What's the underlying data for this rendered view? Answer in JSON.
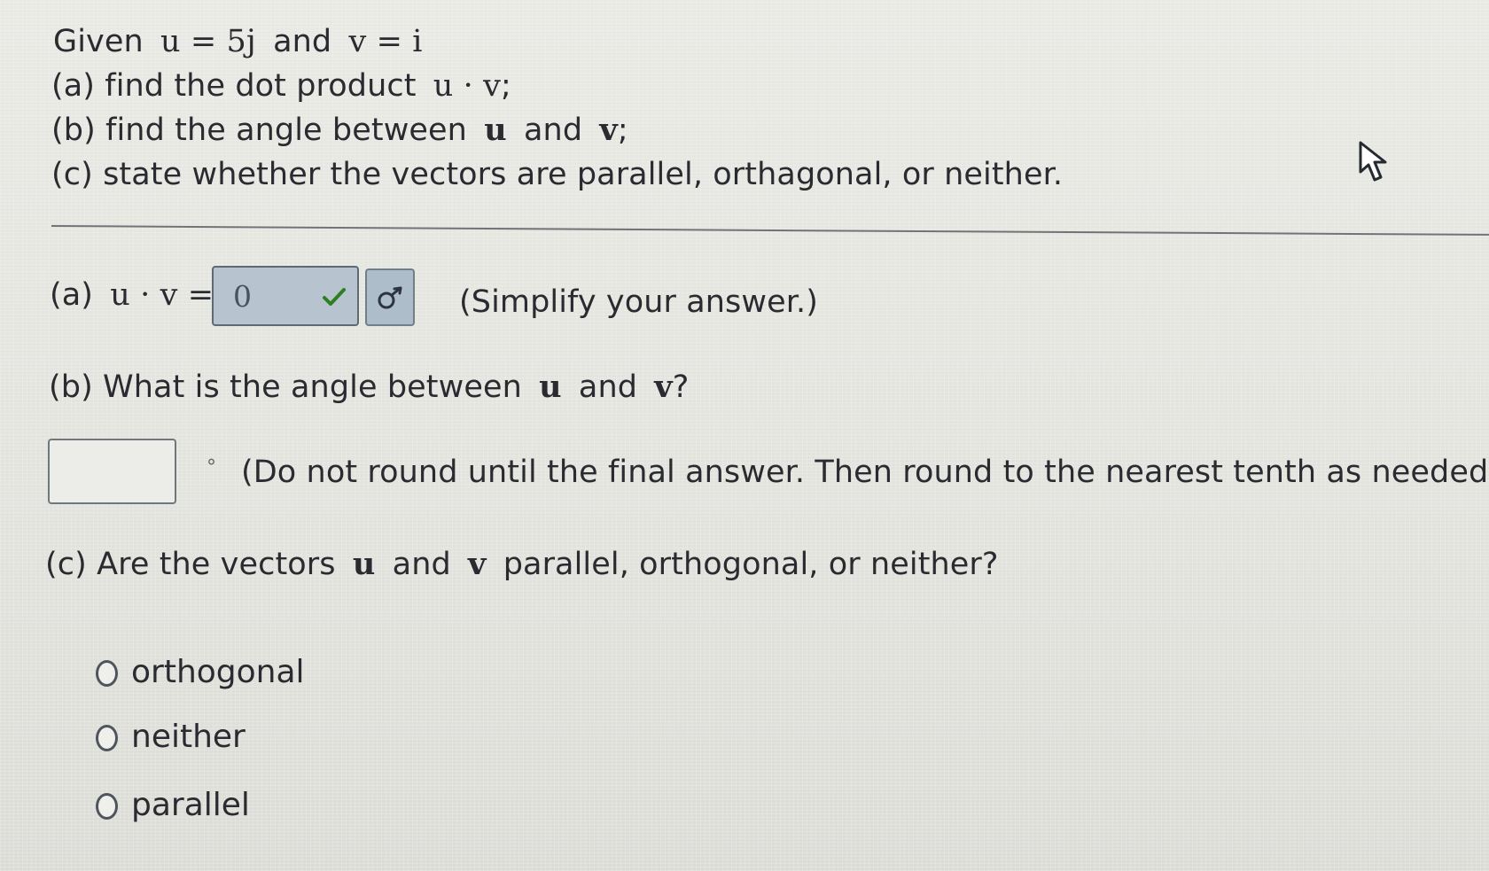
{
  "prompt": {
    "line1": {
      "given": "Given",
      "u_expr": "u = 5j",
      "and": "and",
      "v_expr": "v = i"
    },
    "line2": {
      "prefix": "(a) find the dot product",
      "expr": "u · v",
      "suffix": ";"
    },
    "line3": {
      "prefix": "(b) find the angle between",
      "u": "u",
      "and": "and",
      "v": "v",
      "suffix": ";"
    },
    "line4": "(c) state whether the vectors are parallel, orthagonal, or neither."
  },
  "part_a": {
    "label": "(a)",
    "expr": "u · v =",
    "answer": "0",
    "hint": "(Simplify your answer.)",
    "status_icon": "check-icon",
    "tool_icon": "math-tools-icon",
    "colors": {
      "answer_fill": "#b7c4cf",
      "check": "#2e7f1f"
    }
  },
  "part_b": {
    "question_prefix": "(b) What is the angle between",
    "u": "u",
    "and": "and",
    "v": "v",
    "question_suffix": "?",
    "input_value": "",
    "degree": "°",
    "note": "(Do not round until the final answer. Then round to the nearest tenth as needed.)"
  },
  "part_c": {
    "question_prefix": "(c) Are the vectors",
    "u": "u",
    "and": "and",
    "v": "v",
    "question_suffix": "parallel, orthogonal, or neither?",
    "options": [
      "orthogonal",
      "neither",
      "parallel"
    ]
  },
  "cursor_icon": "mouse-pointer-icon"
}
